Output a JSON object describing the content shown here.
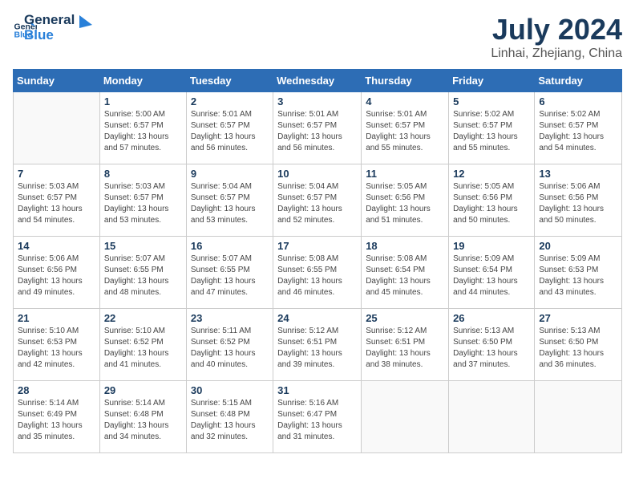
{
  "header": {
    "logo_general": "General",
    "logo_blue": "Blue",
    "month": "July 2024",
    "location": "Linhai, Zhejiang, China"
  },
  "days_of_week": [
    "Sunday",
    "Monday",
    "Tuesday",
    "Wednesday",
    "Thursday",
    "Friday",
    "Saturday"
  ],
  "weeks": [
    [
      {
        "day": "",
        "info": ""
      },
      {
        "day": "1",
        "info": "Sunrise: 5:00 AM\nSunset: 6:57 PM\nDaylight: 13 hours\nand 57 minutes."
      },
      {
        "day": "2",
        "info": "Sunrise: 5:01 AM\nSunset: 6:57 PM\nDaylight: 13 hours\nand 56 minutes."
      },
      {
        "day": "3",
        "info": "Sunrise: 5:01 AM\nSunset: 6:57 PM\nDaylight: 13 hours\nand 56 minutes."
      },
      {
        "day": "4",
        "info": "Sunrise: 5:01 AM\nSunset: 6:57 PM\nDaylight: 13 hours\nand 55 minutes."
      },
      {
        "day": "5",
        "info": "Sunrise: 5:02 AM\nSunset: 6:57 PM\nDaylight: 13 hours\nand 55 minutes."
      },
      {
        "day": "6",
        "info": "Sunrise: 5:02 AM\nSunset: 6:57 PM\nDaylight: 13 hours\nand 54 minutes."
      }
    ],
    [
      {
        "day": "7",
        "info": "Sunrise: 5:03 AM\nSunset: 6:57 PM\nDaylight: 13 hours\nand 54 minutes."
      },
      {
        "day": "8",
        "info": "Sunrise: 5:03 AM\nSunset: 6:57 PM\nDaylight: 13 hours\nand 53 minutes."
      },
      {
        "day": "9",
        "info": "Sunrise: 5:04 AM\nSunset: 6:57 PM\nDaylight: 13 hours\nand 53 minutes."
      },
      {
        "day": "10",
        "info": "Sunrise: 5:04 AM\nSunset: 6:57 PM\nDaylight: 13 hours\nand 52 minutes."
      },
      {
        "day": "11",
        "info": "Sunrise: 5:05 AM\nSunset: 6:56 PM\nDaylight: 13 hours\nand 51 minutes."
      },
      {
        "day": "12",
        "info": "Sunrise: 5:05 AM\nSunset: 6:56 PM\nDaylight: 13 hours\nand 50 minutes."
      },
      {
        "day": "13",
        "info": "Sunrise: 5:06 AM\nSunset: 6:56 PM\nDaylight: 13 hours\nand 50 minutes."
      }
    ],
    [
      {
        "day": "14",
        "info": "Sunrise: 5:06 AM\nSunset: 6:56 PM\nDaylight: 13 hours\nand 49 minutes."
      },
      {
        "day": "15",
        "info": "Sunrise: 5:07 AM\nSunset: 6:55 PM\nDaylight: 13 hours\nand 48 minutes."
      },
      {
        "day": "16",
        "info": "Sunrise: 5:07 AM\nSunset: 6:55 PM\nDaylight: 13 hours\nand 47 minutes."
      },
      {
        "day": "17",
        "info": "Sunrise: 5:08 AM\nSunset: 6:55 PM\nDaylight: 13 hours\nand 46 minutes."
      },
      {
        "day": "18",
        "info": "Sunrise: 5:08 AM\nSunset: 6:54 PM\nDaylight: 13 hours\nand 45 minutes."
      },
      {
        "day": "19",
        "info": "Sunrise: 5:09 AM\nSunset: 6:54 PM\nDaylight: 13 hours\nand 44 minutes."
      },
      {
        "day": "20",
        "info": "Sunrise: 5:09 AM\nSunset: 6:53 PM\nDaylight: 13 hours\nand 43 minutes."
      }
    ],
    [
      {
        "day": "21",
        "info": "Sunrise: 5:10 AM\nSunset: 6:53 PM\nDaylight: 13 hours\nand 42 minutes."
      },
      {
        "day": "22",
        "info": "Sunrise: 5:10 AM\nSunset: 6:52 PM\nDaylight: 13 hours\nand 41 minutes."
      },
      {
        "day": "23",
        "info": "Sunrise: 5:11 AM\nSunset: 6:52 PM\nDaylight: 13 hours\nand 40 minutes."
      },
      {
        "day": "24",
        "info": "Sunrise: 5:12 AM\nSunset: 6:51 PM\nDaylight: 13 hours\nand 39 minutes."
      },
      {
        "day": "25",
        "info": "Sunrise: 5:12 AM\nSunset: 6:51 PM\nDaylight: 13 hours\nand 38 minutes."
      },
      {
        "day": "26",
        "info": "Sunrise: 5:13 AM\nSunset: 6:50 PM\nDaylight: 13 hours\nand 37 minutes."
      },
      {
        "day": "27",
        "info": "Sunrise: 5:13 AM\nSunset: 6:50 PM\nDaylight: 13 hours\nand 36 minutes."
      }
    ],
    [
      {
        "day": "28",
        "info": "Sunrise: 5:14 AM\nSunset: 6:49 PM\nDaylight: 13 hours\nand 35 minutes."
      },
      {
        "day": "29",
        "info": "Sunrise: 5:14 AM\nSunset: 6:48 PM\nDaylight: 13 hours\nand 34 minutes."
      },
      {
        "day": "30",
        "info": "Sunrise: 5:15 AM\nSunset: 6:48 PM\nDaylight: 13 hours\nand 32 minutes."
      },
      {
        "day": "31",
        "info": "Sunrise: 5:16 AM\nSunset: 6:47 PM\nDaylight: 13 hours\nand 31 minutes."
      },
      {
        "day": "",
        "info": ""
      },
      {
        "day": "",
        "info": ""
      },
      {
        "day": "",
        "info": ""
      }
    ]
  ]
}
